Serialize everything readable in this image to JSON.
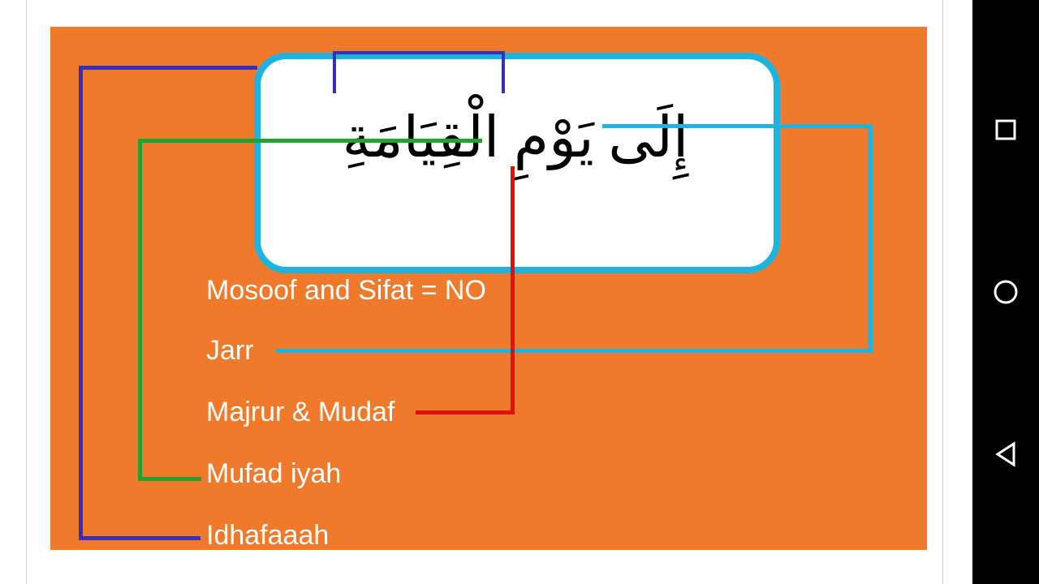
{
  "arabic_phrase": "إِلَى يَوْمِ الْقِيَامَةِ",
  "labels": {
    "mosoof_sifat": "Mosoof and Sifat = NO",
    "jarr": "Jarr",
    "majrur_mudaf": "Majrur & Mudaf",
    "mufad_iyah": "Mufad iyah",
    "idhafaaah": "Idhafaaah"
  },
  "colors": {
    "slide_bg": "#f07a2c",
    "box_border": "#1db3e0",
    "jarr_line": "#1db3e0",
    "majrur_line": "#e01010",
    "mufad_line": "#22a030",
    "idhafaaah_line": "#3a2fb8",
    "bracket": "#3a2fb8"
  },
  "nav": {
    "recent": "recent-apps-icon",
    "home": "home-icon",
    "back": "back-icon"
  }
}
